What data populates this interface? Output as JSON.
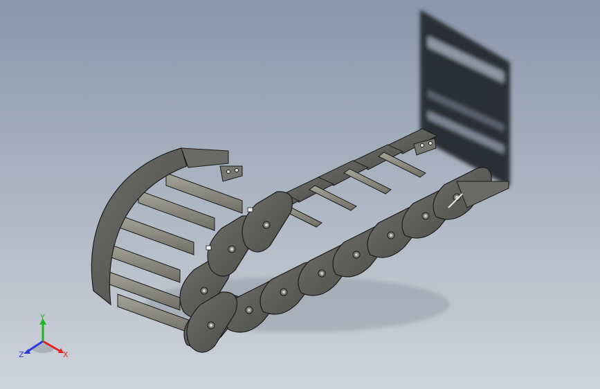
{
  "viewport": {
    "background_top": "#8a97aa",
    "background_bottom": "#cfd4dc",
    "model": "cable-drag-chain"
  },
  "triad": {
    "x_label": "X",
    "y_label": "Y",
    "z_label": "Z",
    "x_color": "#e0241c",
    "y_color": "#23b02a",
    "z_color": "#2a3ad8"
  },
  "chain": {
    "link_color": "#5e5f5b",
    "crossbar_color": "#8b8b80",
    "edge_color": "#1c1c1c",
    "pin_color": "#d8d8d8",
    "shadow_color": "#2b2f36"
  }
}
